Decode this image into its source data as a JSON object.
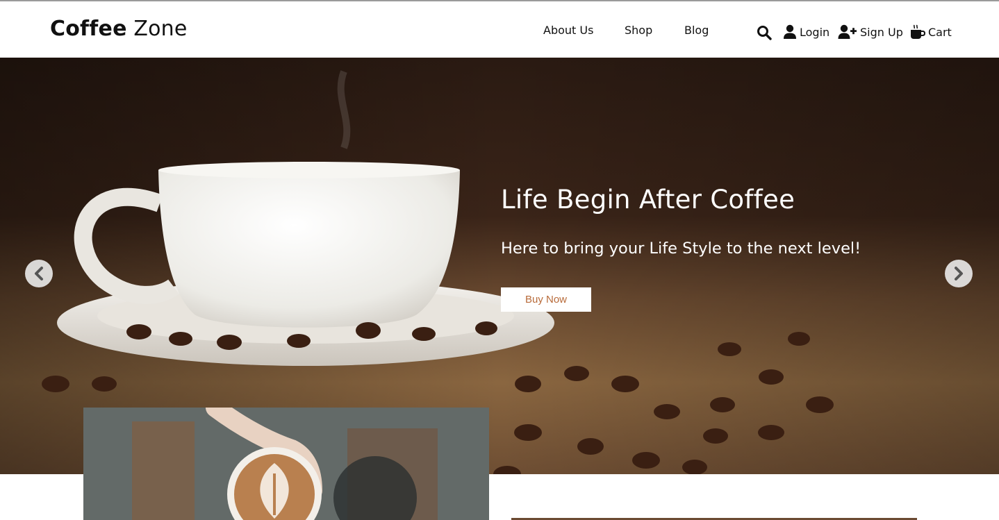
{
  "brand": {
    "bold": "Coffee",
    "light": " Zone"
  },
  "nav": {
    "about": "About Us",
    "shop": "Shop",
    "blog": "Blog"
  },
  "actions": {
    "search_icon": "search-icon",
    "login": "Login",
    "signup": "Sign Up",
    "cart": "Cart"
  },
  "hero": {
    "title": "Life Begin After Coffee",
    "subtitle": "Here to bring your Life Style to the next level!",
    "button": "Buy Now"
  },
  "colors": {
    "accent": "#b86b3a",
    "hero_dark": "#2a1a12",
    "burlap": "#8a6640"
  }
}
